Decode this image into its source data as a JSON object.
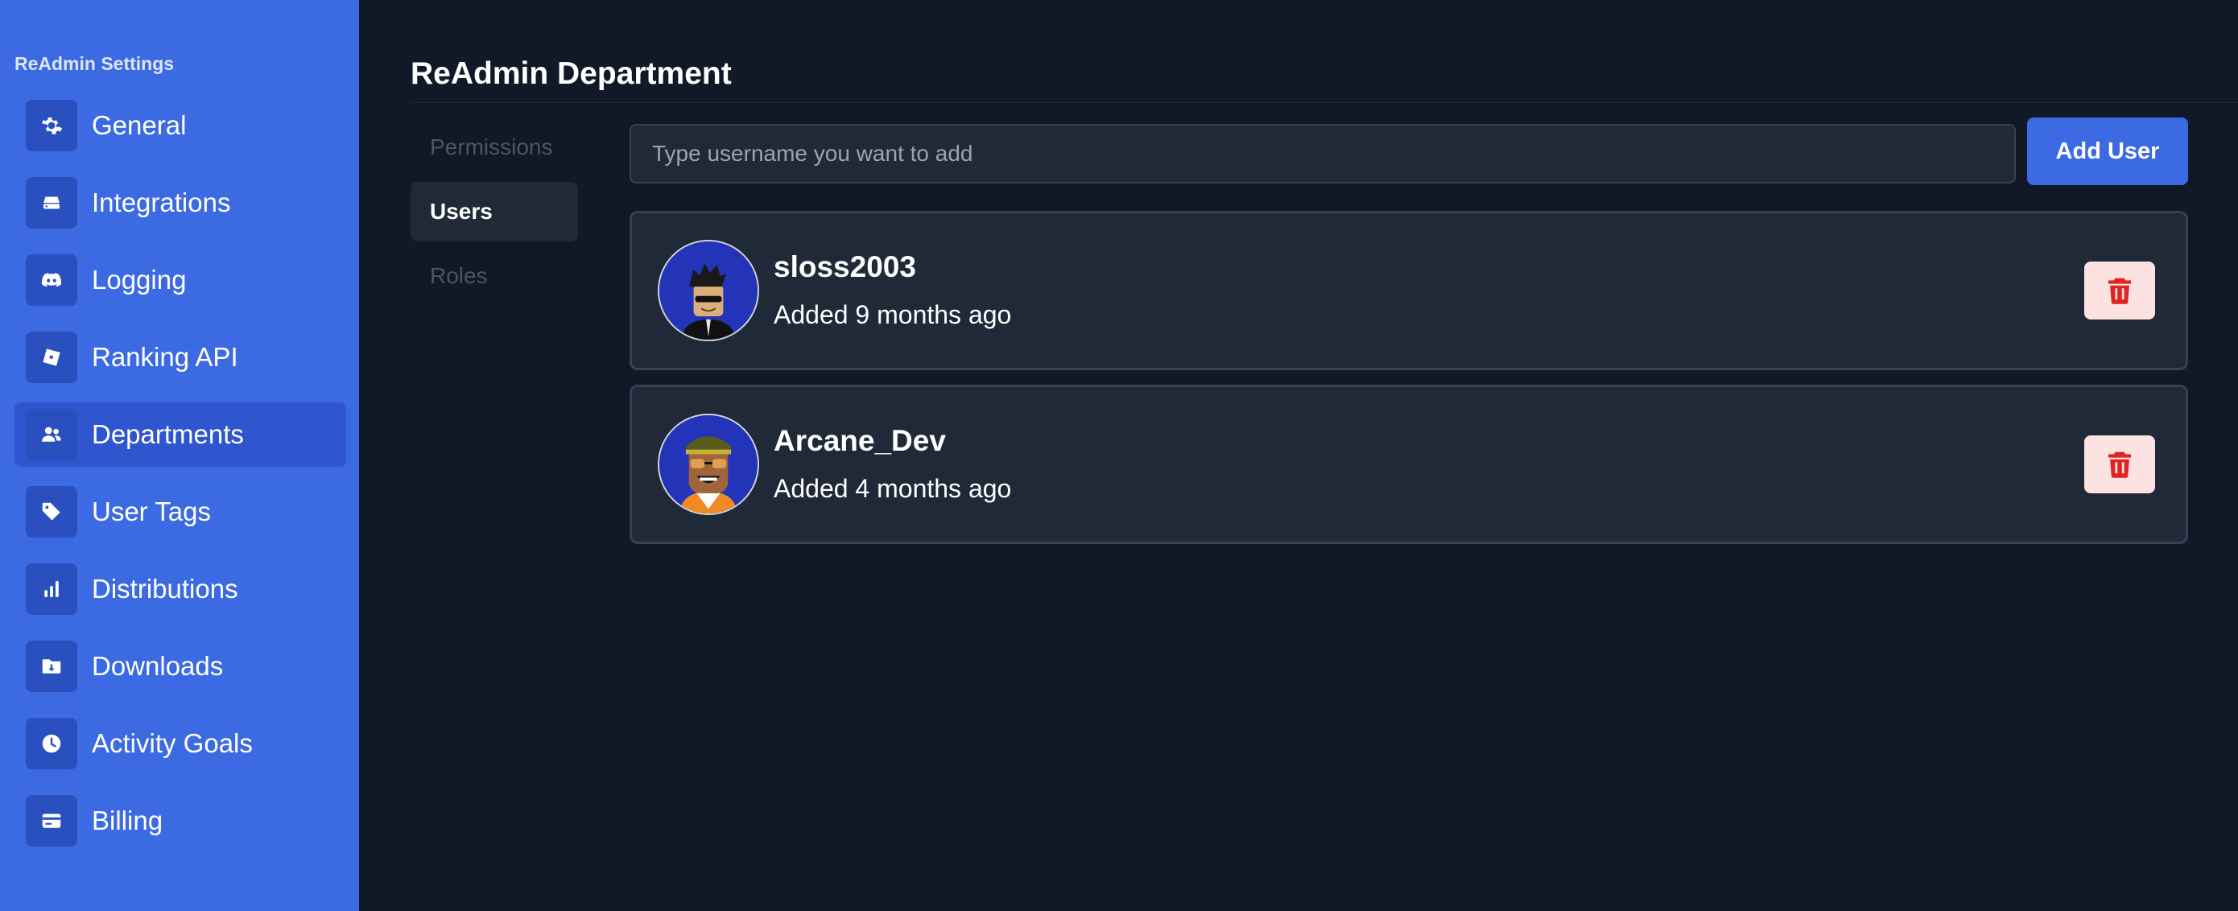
{
  "sidebar": {
    "title": "ReAdmin Settings",
    "items": [
      {
        "label": "General",
        "icon": "gear-icon"
      },
      {
        "label": "Integrations",
        "icon": "integrations-icon"
      },
      {
        "label": "Logging",
        "icon": "discord-icon"
      },
      {
        "label": "Ranking API",
        "icon": "roblox-icon"
      },
      {
        "label": "Departments",
        "icon": "users-icon"
      },
      {
        "label": "User Tags",
        "icon": "tag-icon"
      },
      {
        "label": "Distributions",
        "icon": "bar-chart-icon"
      },
      {
        "label": "Downloads",
        "icon": "download-folder-icon"
      },
      {
        "label": "Activity Goals",
        "icon": "clock-icon"
      },
      {
        "label": "Billing",
        "icon": "credit-card-icon"
      }
    ],
    "active": "Departments"
  },
  "main": {
    "title": "ReAdmin Department",
    "tabs": [
      {
        "label": "Permissions"
      },
      {
        "label": "Users"
      },
      {
        "label": "Roles"
      }
    ],
    "active_tab": "Users",
    "search": {
      "placeholder": "Type username you want to add",
      "value": ""
    },
    "add_button_label": "Add User",
    "users": [
      {
        "username": "sloss2003",
        "added": "Added 9 months ago",
        "icon": "trash-icon"
      },
      {
        "username": "Arcane_Dev",
        "added": "Added 4 months ago",
        "icon": "trash-icon"
      }
    ]
  },
  "colors": {
    "sidebar_bg": "#3b6ae3",
    "active_item_bg": "#2f55cf",
    "page_bg": "#111827",
    "card_bg": "#1f2937",
    "delete_bg": "#fde2e2",
    "delete_icon": "#e02424"
  }
}
